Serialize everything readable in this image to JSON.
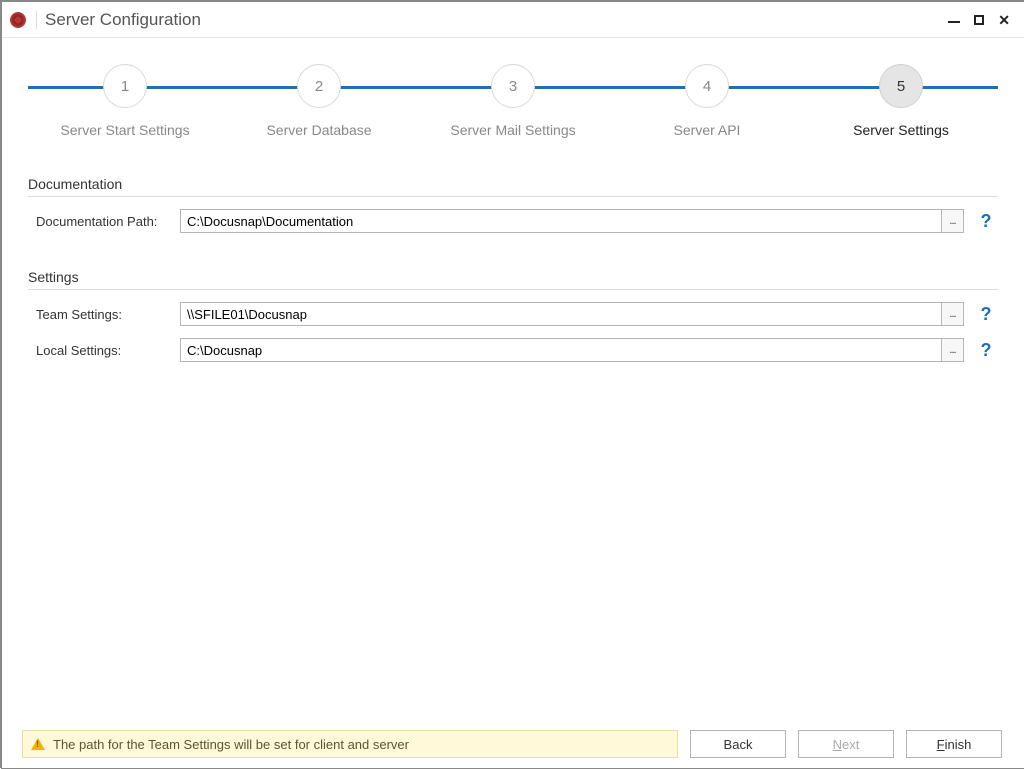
{
  "window": {
    "title": "Server Configuration"
  },
  "stepper": {
    "steps": [
      {
        "num": "1",
        "label": "Server Start Settings",
        "active": false
      },
      {
        "num": "2",
        "label": "Server Database",
        "active": false
      },
      {
        "num": "3",
        "label": "Server Mail Settings",
        "active": false
      },
      {
        "num": "4",
        "label": "Server API",
        "active": false
      },
      {
        "num": "5",
        "label": "Server Settings",
        "active": true
      }
    ]
  },
  "sections": {
    "documentation": {
      "title": "Documentation",
      "path_label": "Documentation Path:",
      "path_value": "C:\\Docusnap\\Documentation"
    },
    "settings": {
      "title": "Settings",
      "team_label": "Team Settings:",
      "team_value": "\\\\SFILE01\\Docusnap",
      "local_label": "Local Settings:",
      "local_value": "C:\\Docusnap"
    }
  },
  "footer": {
    "status": "The path for the Team Settings will be set for client and server",
    "back": "Back",
    "next_pre": "N",
    "next_rest": "ext",
    "finish_pre": "F",
    "finish_rest": "inish"
  },
  "glyphs": {
    "ellipsis": "...",
    "help": "?",
    "close": "✕"
  }
}
